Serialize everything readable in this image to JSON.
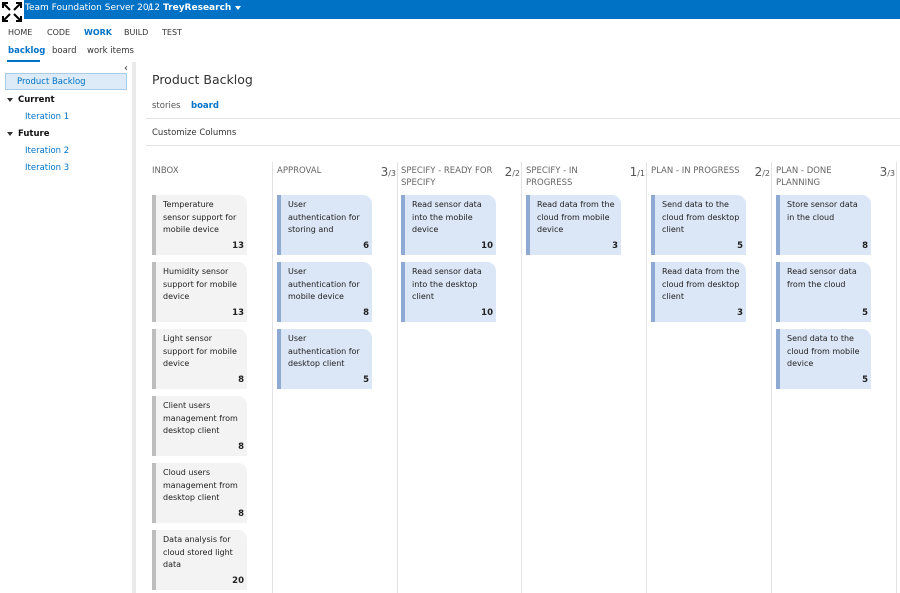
{
  "header": {
    "app_title": "Team Foundation Server 2012",
    "separator": "/",
    "project": "TreyResearch"
  },
  "main_nav": [
    "HOME",
    "CODE",
    "WORK",
    "BUILD",
    "TEST"
  ],
  "sub_nav": [
    "backlog",
    "board",
    "work items"
  ],
  "sidebar": {
    "selected": "Product Backlog",
    "current_label": "Current",
    "current_items": [
      "Iteration 1"
    ],
    "future_label": "Future",
    "future_items": [
      "Iteration 2",
      "Iteration 3"
    ]
  },
  "content": {
    "title": "Product Backlog",
    "view_tabs": [
      "stories",
      "board"
    ],
    "customize_label": "Customize Columns"
  },
  "board": {
    "columns": [
      {
        "name": "INBOX",
        "wip": "",
        "limit": "",
        "cards": [
          {
            "title": "Temperature sensor support for mobile device",
            "effort": "13"
          },
          {
            "title": "Humidity sensor support for mobile device",
            "effort": "13"
          },
          {
            "title": "Light sensor support for mobile device",
            "effort": "8"
          },
          {
            "title": "Client users management from desktop client",
            "effort": "8"
          },
          {
            "title": "Cloud users management from desktop client",
            "effort": "8"
          },
          {
            "title": "Data analysis for cloud stored light data",
            "effort": "20"
          }
        ]
      },
      {
        "name": "APPROVAL",
        "wip": "3",
        "limit": "/3",
        "cards": [
          {
            "title": "User authentication for storing and reading data in the",
            "effort": "6"
          },
          {
            "title": "User authentication for mobile device",
            "effort": "8"
          },
          {
            "title": "User authentication for desktop client",
            "effort": "5"
          }
        ]
      },
      {
        "name": "SPECIFY - READY FOR SPECIFY",
        "wip": "2",
        "limit": "/2",
        "cards": [
          {
            "title": "Read sensor data into the mobile device",
            "effort": "10"
          },
          {
            "title": "Read sensor data into the desktop client",
            "effort": "10"
          }
        ]
      },
      {
        "name": "SPECIFY - IN PROGRESS",
        "wip": "1",
        "limit": "/1",
        "cards": [
          {
            "title": "Read data from the cloud from mobile device",
            "effort": "3"
          }
        ]
      },
      {
        "name": "PLAN - IN PROGRESS",
        "wip": "2",
        "limit": "/2",
        "cards": [
          {
            "title": "Send data to the cloud from desktop client",
            "effort": "5"
          },
          {
            "title": "Read data from the cloud from desktop client",
            "effort": "3"
          }
        ]
      },
      {
        "name": "PLAN - DONE PLANNING",
        "wip": "3",
        "limit": "/3",
        "cards": [
          {
            "title": "Store sensor data in the cloud",
            "effort": "8"
          },
          {
            "title": "Read sensor data from the cloud",
            "effort": "5"
          },
          {
            "title": "Send data to the cloud from mobile device",
            "effort": "5"
          }
        ]
      }
    ]
  },
  "colors": {
    "brand_blue": "#0072c6",
    "card_new_bg": "#f3f3f3",
    "card_new_stripe": "#bdbdbd",
    "card_active_bg": "#dbe6f6",
    "card_active_stripe": "#8eaad3"
  },
  "icons": {
    "expand": "expand-icon",
    "project_menu": "chevron-down-icon",
    "collapse": "chevron-left-icon",
    "tree_toggle": "triangle-down-icon"
  }
}
